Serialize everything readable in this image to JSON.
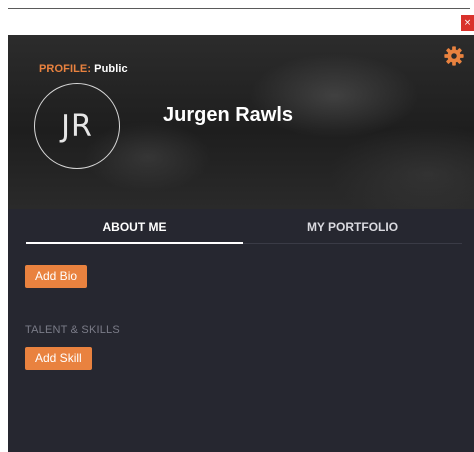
{
  "window": {
    "close_glyph": "×"
  },
  "header": {
    "profile_label": "PROFILE:",
    "profile_visibility": "Public",
    "settings_icon": "gear-icon"
  },
  "user": {
    "initials": "JR",
    "name": "Jurgen Rawls"
  },
  "tabs": [
    {
      "label": "ABOUT ME",
      "active": true
    },
    {
      "label": "MY PORTFOLIO",
      "active": false
    }
  ],
  "about": {
    "add_bio_label": "Add Bio",
    "skills_section_label": "TALENT & SKILLS",
    "add_skill_label": "Add Skill"
  },
  "colors": {
    "accent": "#e9823f",
    "panel_bg": "#262730",
    "close_red": "#d9322c",
    "muted_text": "#7b7c88"
  }
}
